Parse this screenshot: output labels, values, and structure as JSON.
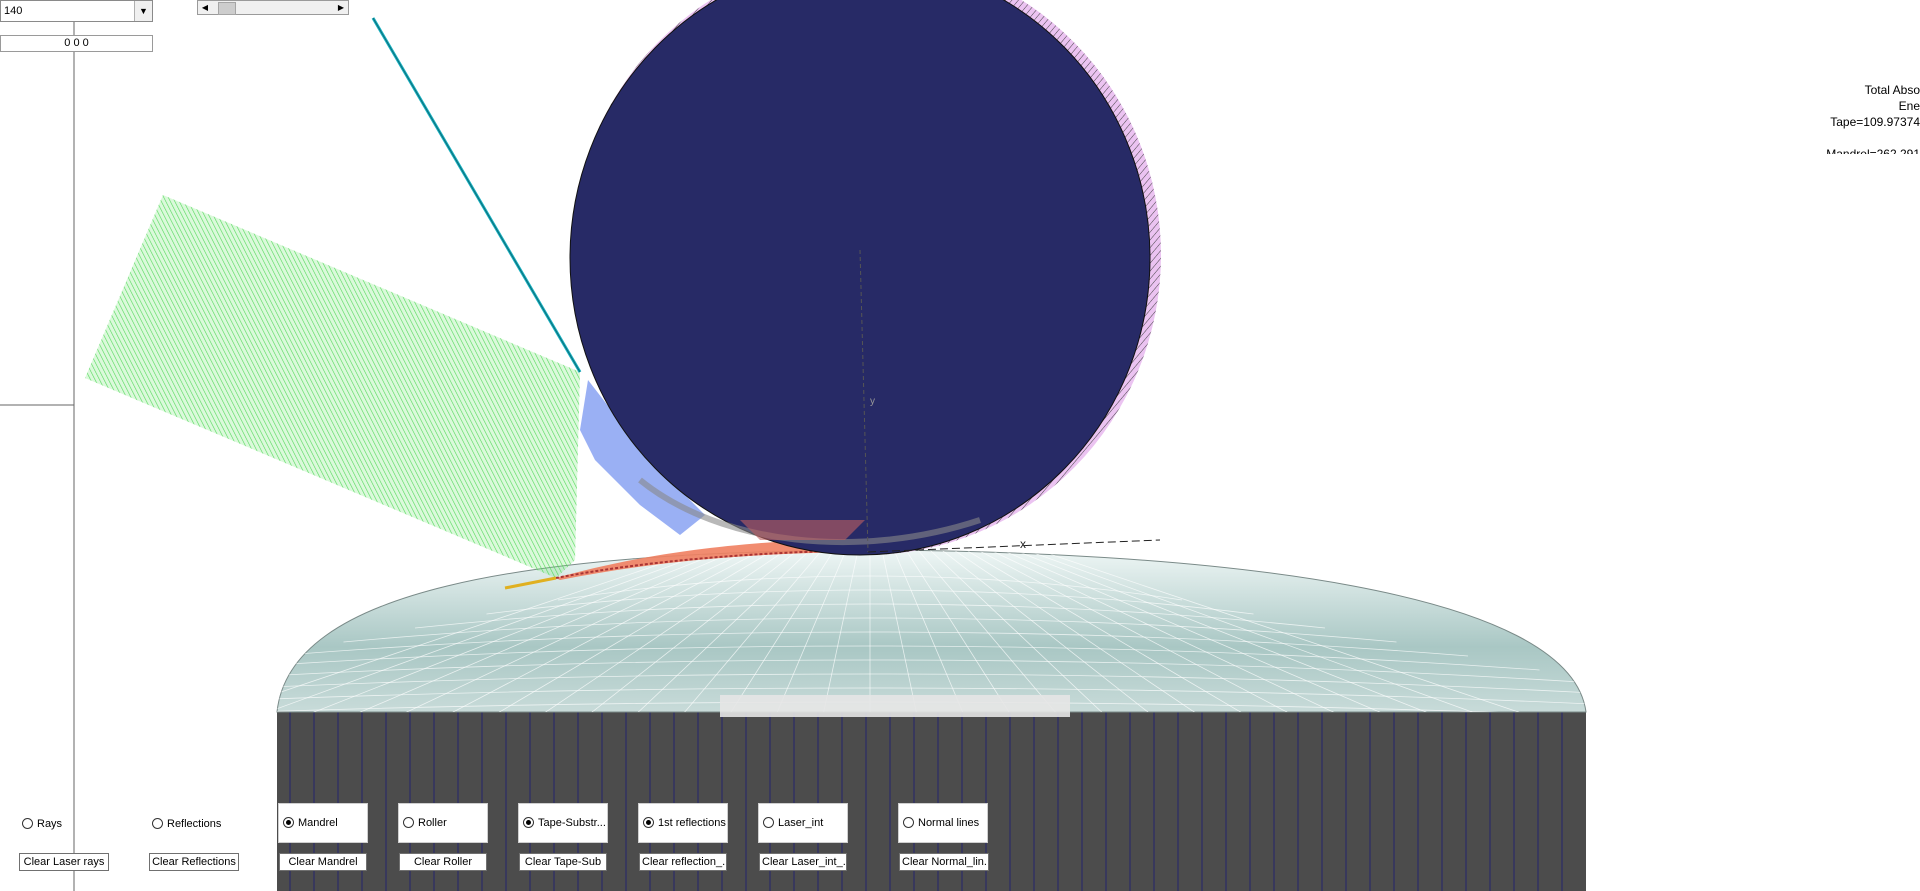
{
  "top_controls": {
    "dropdown_value": "140",
    "coord_field": "0 0 0",
    "scroll_value": 20
  },
  "energy_panel": {
    "line1": "Total Abso",
    "line2": "Ene",
    "line3": "Tape=109.97374",
    "line4": "Mandrel=262.291"
  },
  "toggles": [
    {
      "label": "Rays",
      "checked": false
    },
    {
      "label": "Reflections",
      "checked": false
    },
    {
      "label": "Mandrel",
      "checked": true
    },
    {
      "label": "Roller",
      "checked": false
    },
    {
      "label": "Tape-Substr...",
      "checked": true
    },
    {
      "label": "1st reflections",
      "checked": true
    },
    {
      "label": "Laser_int",
      "checked": false
    },
    {
      "label": "Normal lines",
      "checked": false
    }
  ],
  "buttons": [
    "Clear Laser rays",
    "Clear Reflections",
    "Clear Mandrel",
    "Clear Roller",
    "Clear Tape-Sub",
    "Clear reflection_...",
    "Clear Laser_int_...",
    "Clear Normal_lin..."
  ],
  "colors": {
    "roller": "#272a66",
    "roller_edge_hatch": "#333333",
    "roller_tint": "#d9a8df",
    "laser_rays": "#49e04c",
    "reflections": "#6f8ff0",
    "tape": "#f08060",
    "tape_edge": "#e0b020",
    "mandrel_dome": "#b7d2cf",
    "mandrel_body": "#4c4c4c",
    "mandrel_grid": "#1d1d6a",
    "laser_beam": "#18b0c0"
  },
  "scene_labels": {
    "axis_y": "y",
    "axis_x": "x"
  }
}
